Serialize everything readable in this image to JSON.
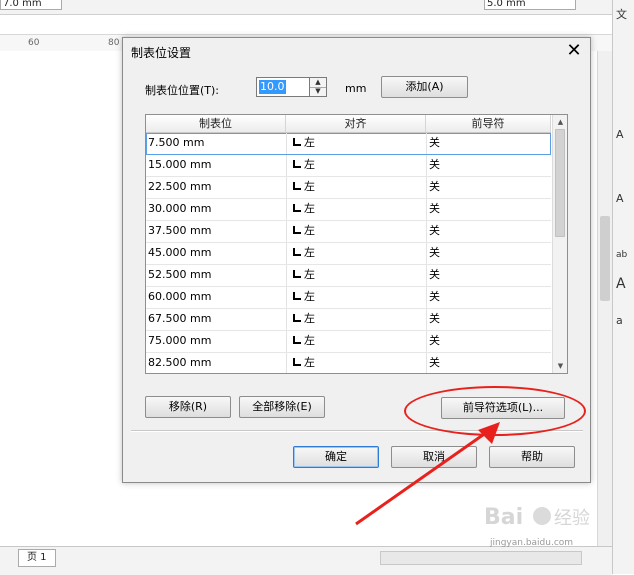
{
  "background": {
    "toolbar_fields": [
      "7.0 mm",
      "5.0 mm"
    ],
    "ruler_ticks": [
      "60",
      "80"
    ],
    "right_panel_items": [
      "文",
      "A",
      "A",
      "ab",
      "A",
      "a"
    ],
    "page_tab": "页 1"
  },
  "dialog": {
    "title": "制表位设置",
    "position_label": "制表位位置(T):",
    "position_value": "10.0",
    "unit": "mm",
    "add_button": "添加(A)",
    "columns": [
      "制表位",
      "对齐",
      "前导符"
    ],
    "rows": [
      {
        "pos": "7.500 mm",
        "align": "左",
        "leader": "关"
      },
      {
        "pos": "15.000 mm",
        "align": "左",
        "leader": "关"
      },
      {
        "pos": "22.500 mm",
        "align": "左",
        "leader": "关"
      },
      {
        "pos": "30.000 mm",
        "align": "左",
        "leader": "关"
      },
      {
        "pos": "37.500 mm",
        "align": "左",
        "leader": "关"
      },
      {
        "pos": "45.000 mm",
        "align": "左",
        "leader": "关"
      },
      {
        "pos": "52.500 mm",
        "align": "左",
        "leader": "关"
      },
      {
        "pos": "60.000 mm",
        "align": "左",
        "leader": "关"
      },
      {
        "pos": "67.500 mm",
        "align": "左",
        "leader": "关"
      },
      {
        "pos": "75.000 mm",
        "align": "左",
        "leader": "关"
      },
      {
        "pos": "82.500 mm",
        "align": "左",
        "leader": "关"
      }
    ],
    "remove_button": "移除(R)",
    "remove_all_button": "全部移除(E)",
    "leader_options_button": "前导符选项(L)...",
    "ok_button": "确定",
    "cancel_button": "取消",
    "help_button": "帮助"
  },
  "annotation": {
    "color": "#e8211c"
  },
  "watermark": {
    "text": "jingyan.baidu.com"
  }
}
